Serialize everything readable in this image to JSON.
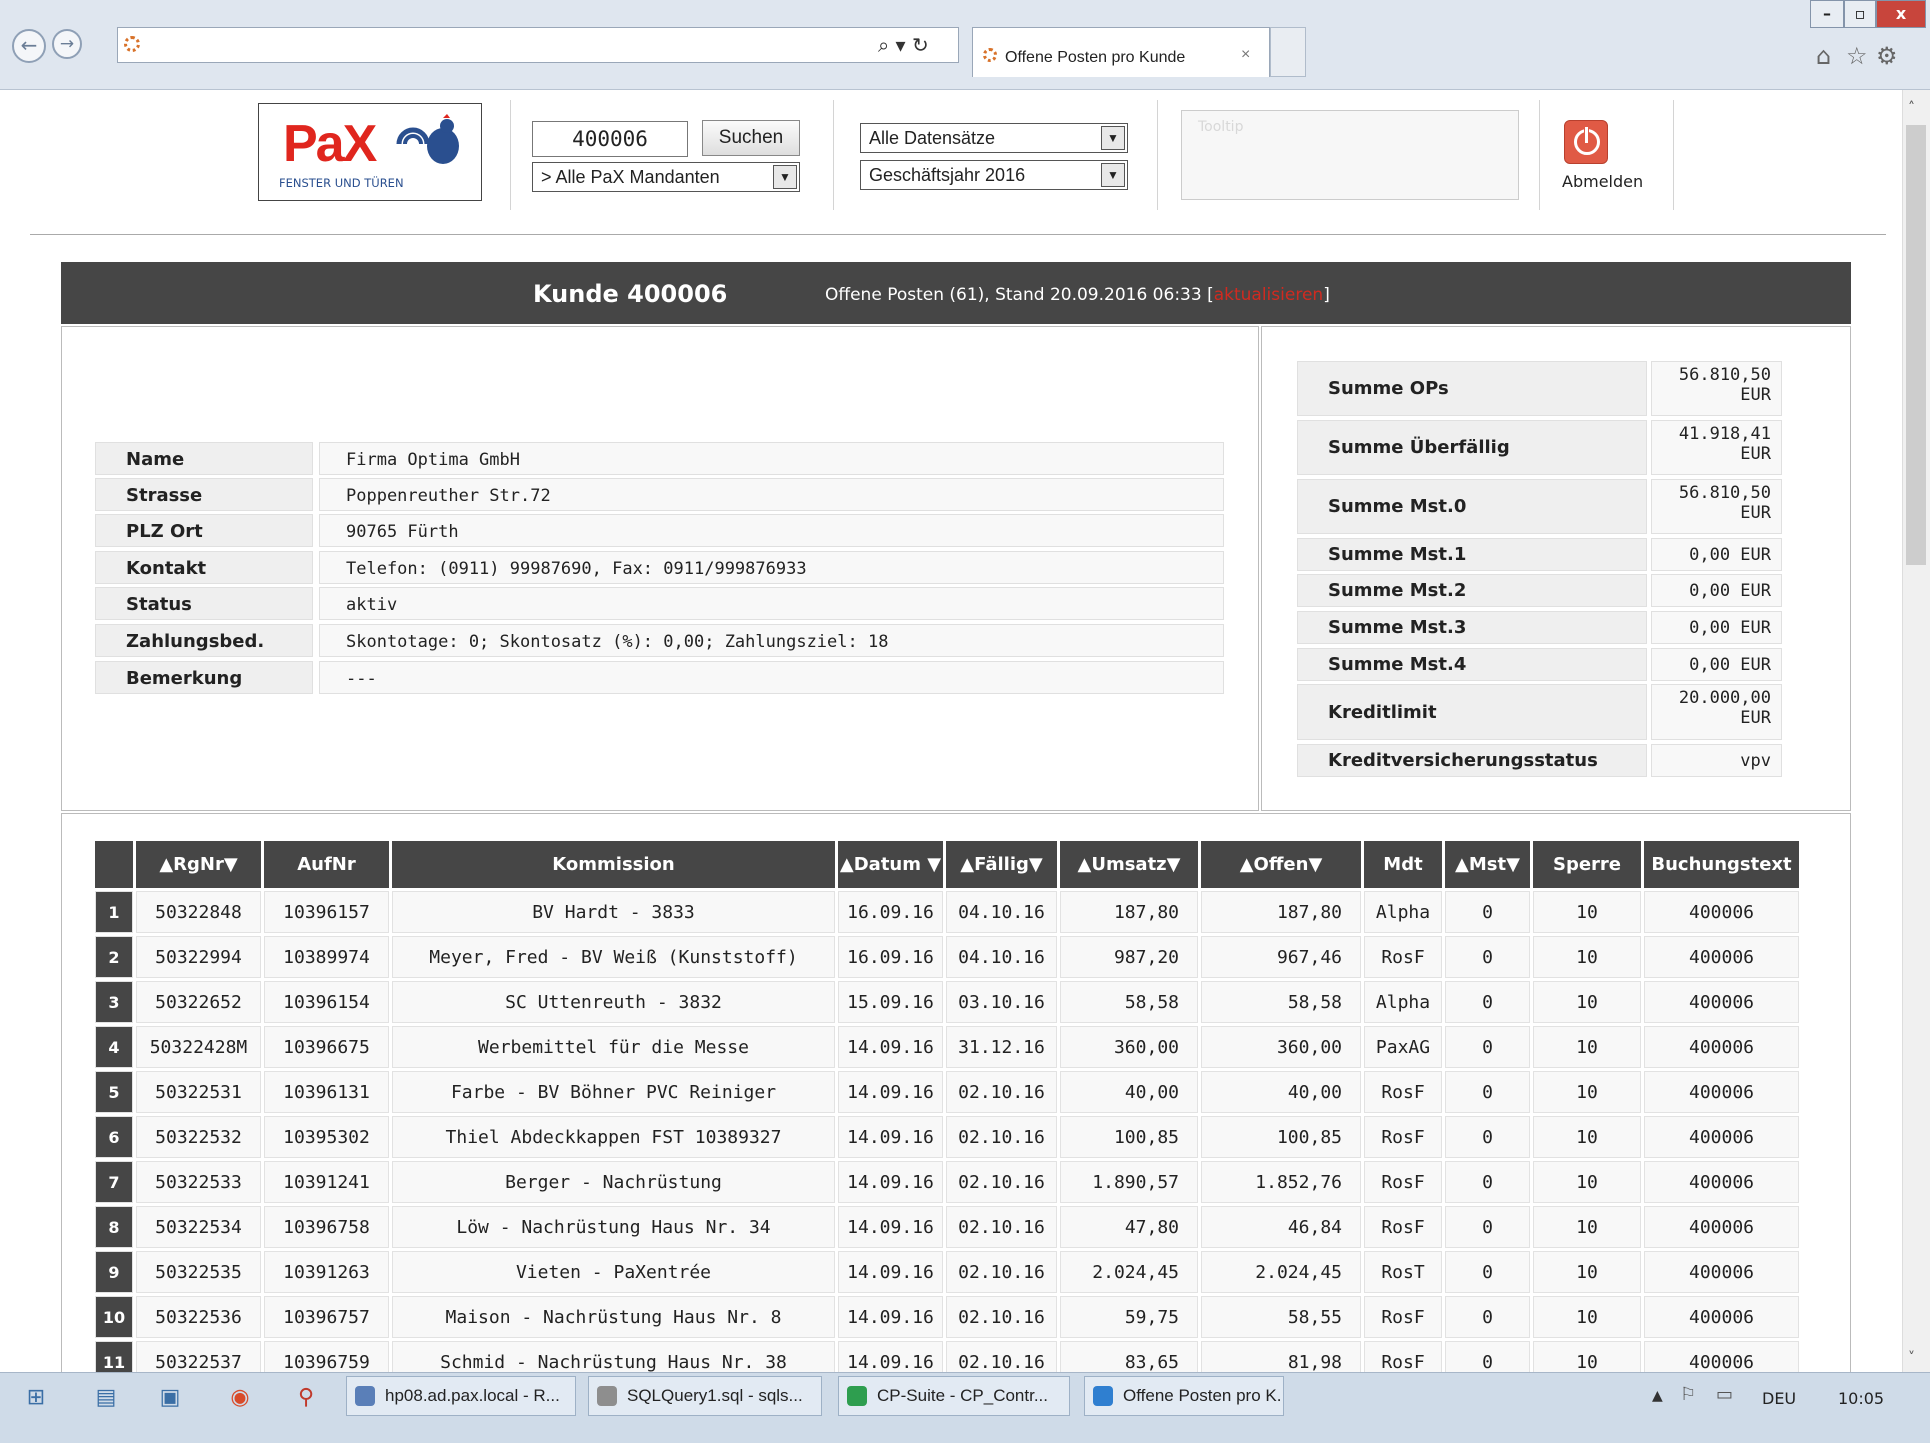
{
  "browser": {
    "tab_title": "Offene Posten pro Kunde",
    "tab_close": "×",
    "addr_ctrl": "⌕ ▾ ↻",
    "back": "←",
    "forward": "→",
    "win_min": "–",
    "win_max": "▫",
    "win_close": "x",
    "home": "⌂",
    "star": "☆",
    "gear": "⚙"
  },
  "header": {
    "logo_text": "PaX",
    "logo_sub": "FENSTER UND TÜREN",
    "customer_input": "400006",
    "search_label": "Suchen",
    "mandant_select": "> Alle PaX Mandanten",
    "records_select": "Alle Datensätze",
    "year_select": "Geschäftsjahr 2016",
    "tooltip": "Tooltip",
    "logout_label": "Abmelden"
  },
  "kunde": {
    "title": "Kunde 400006",
    "subtitle": "Offene Posten (61), Stand 20.09.2016 06:33 [",
    "subtitle_link": "aktualisieren",
    "subtitle_end": "]"
  },
  "info": [
    {
      "label": "Name",
      "value": "Firma Optima GmbH"
    },
    {
      "label": "Strasse",
      "value": "Poppenreuther Str.72"
    },
    {
      "label": "PLZ Ort",
      "value": "90765 Fürth"
    },
    {
      "label": "Kontakt",
      "value": "Telefon: (0911) 99987690, Fax: 0911/999876933"
    },
    {
      "label": "Status",
      "value": "aktiv"
    },
    {
      "label": "Zahlungsbed.",
      "value": "Skontotage: 0; Skontosatz (%): 0,00; Zahlungsziel: 18"
    },
    {
      "label": "Bemerkung",
      "value": "---"
    }
  ],
  "summary": [
    {
      "label": "Summe OPs",
      "value": "56.810,50 EUR"
    },
    {
      "label": "Summe Überfällig",
      "value": "41.918,41 EUR"
    },
    {
      "label": "Summe Mst.0",
      "value": "56.810,50 EUR"
    },
    {
      "label": "Summe Mst.1",
      "value": "0,00 EUR"
    },
    {
      "label": "Summe Mst.2",
      "value": "0,00 EUR"
    },
    {
      "label": "Summe Mst.3",
      "value": "0,00 EUR"
    },
    {
      "label": "Summe Mst.4",
      "value": "0,00 EUR"
    },
    {
      "label": "Kreditlimit",
      "value": "20.000,00 EUR"
    },
    {
      "label": "Kreditversicherungsstatus",
      "value": "vpv"
    }
  ],
  "table": {
    "columns": [
      "",
      "▲RgNr▼",
      "AufNr",
      "Kommission",
      "▲Datum ▼",
      "▲Fällig▼",
      "▲Umsatz▼",
      "▲Offen▼",
      "Mdt",
      "▲Mst▼",
      "Sperre",
      "Buchungstext"
    ],
    "rows": [
      [
        "1",
        "50322848",
        "10396157",
        "BV Hardt - 3833",
        "16.09.16",
        "04.10.16",
        "187,80",
        "187,80",
        "Alpha",
        "0",
        "10",
        "400006"
      ],
      [
        "2",
        "50322994",
        "10389974",
        "Meyer, Fred - BV Weiß (Kunststoff)",
        "16.09.16",
        "04.10.16",
        "987,20",
        "967,46",
        "RosF",
        "0",
        "10",
        "400006"
      ],
      [
        "3",
        "50322652",
        "10396154",
        "SC Uttenreuth - 3832",
        "15.09.16",
        "03.10.16",
        "58,58",
        "58,58",
        "Alpha",
        "0",
        "10",
        "400006"
      ],
      [
        "4",
        "50322428M",
        "10396675",
        "Werbemittel für die Messe",
        "14.09.16",
        "31.12.16",
        "360,00",
        "360,00",
        "PaxAG",
        "0",
        "10",
        "400006"
      ],
      [
        "5",
        "50322531",
        "10396131",
        "Farbe - BV Böhner PVC Reiniger",
        "14.09.16",
        "02.10.16",
        "40,00",
        "40,00",
        "RosF",
        "0",
        "10",
        "400006"
      ],
      [
        "6",
        "50322532",
        "10395302",
        "Thiel Abdeckkappen FST 10389327",
        "14.09.16",
        "02.10.16",
        "100,85",
        "100,85",
        "RosF",
        "0",
        "10",
        "400006"
      ],
      [
        "7",
        "50322533",
        "10391241",
        "Berger - Nachrüstung",
        "14.09.16",
        "02.10.16",
        "1.890,57",
        "1.852,76",
        "RosF",
        "0",
        "10",
        "400006"
      ],
      [
        "8",
        "50322534",
        "10396758",
        "Löw - Nachrüstung Haus Nr. 34",
        "14.09.16",
        "02.10.16",
        "47,80",
        "46,84",
        "RosF",
        "0",
        "10",
        "400006"
      ],
      [
        "9",
        "50322535",
        "10391263",
        "Vieten - PaXentrée",
        "14.09.16",
        "02.10.16",
        "2.024,45",
        "2.024,45",
        "RosT",
        "0",
        "10",
        "400006"
      ],
      [
        "10",
        "50322536",
        "10396757",
        "Maison - Nachrüstung Haus Nr. 8",
        "14.09.16",
        "02.10.16",
        "59,75",
        "58,55",
        "RosF",
        "0",
        "10",
        "400006"
      ],
      [
        "11",
        "50322537",
        "10396759",
        "Schmid - Nachrüstung Haus Nr. 38",
        "14.09.16",
        "02.10.16",
        "83,65",
        "81,98",
        "RosF",
        "0",
        "10",
        "400006"
      ]
    ]
  },
  "taskbar": {
    "items": [
      "hp08.ad.pax.local - R...",
      "SQLQuery1.sql - sqls...",
      "CP-Suite - CP_Contr...",
      "Offene Posten pro K..."
    ],
    "lang": "DEU",
    "time": "10:05"
  }
}
